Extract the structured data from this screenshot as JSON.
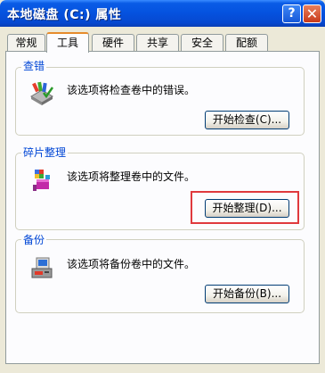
{
  "window": {
    "title": "本地磁盘 (C:) 属性"
  },
  "titlebar": {
    "help_label": "?",
    "close_label": "✕"
  },
  "tabs": [
    {
      "label": "常规"
    },
    {
      "label": "工具"
    },
    {
      "label": "硬件"
    },
    {
      "label": "共享"
    },
    {
      "label": "安全"
    },
    {
      "label": "配额"
    }
  ],
  "active_tab": "工具",
  "sections": {
    "check": {
      "title": "查错",
      "description": "该选项将检查卷中的错误。",
      "button": "开始检查(C)...",
      "icon": "disk-check-icon"
    },
    "defrag": {
      "title": "碎片整理",
      "description": "该选项将整理卷中的文件。",
      "button": "开始整理(D)...",
      "icon": "defrag-icon"
    },
    "backup": {
      "title": "备份",
      "description": "该选项将备份卷中的文件。",
      "button": "开始备份(B)...",
      "icon": "backup-icon"
    }
  },
  "colors": {
    "titlebar": "#0553E0",
    "group_label": "#0046D5",
    "highlight": "#E0393D",
    "panel": "#FCFCFE",
    "dialog": "#ECE9D8"
  }
}
